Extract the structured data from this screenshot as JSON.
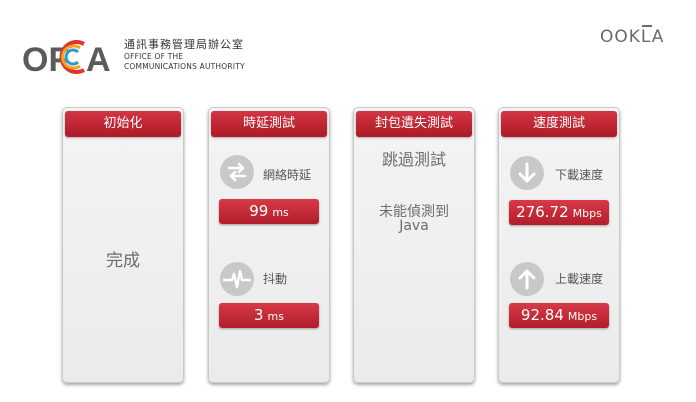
{
  "header": {
    "logo_mark": "OFCA",
    "logo_cn": "通訊事務管理局辦公室",
    "logo_en_line1": "OFFICE OF THE",
    "logo_en_line2": "COMMUNICATIONS AUTHORITY",
    "ookla": "OOKLA"
  },
  "colors": {
    "accent": "#c0222f",
    "panel_bg": "#efefef",
    "icon_gray": "#c8c8c8"
  },
  "panels": {
    "init": {
      "title": "初始化",
      "status": "完成"
    },
    "latency": {
      "title": "時延測試",
      "latency_label": "網絡時延",
      "latency_value": "99",
      "latency_unit": "ms",
      "jitter_label": "抖動",
      "jitter_value": "3",
      "jitter_unit": "ms",
      "latency_icon": "swap-arrows-icon",
      "jitter_icon": "waveform-icon"
    },
    "packet_loss": {
      "title": "封包遺失測試",
      "skip_text": "跳過測試",
      "java_text_line1": "未能偵測到",
      "java_text_line2": "Java"
    },
    "speed": {
      "title": "速度測試",
      "download_label": "下載速度",
      "download_value": "276.72",
      "download_unit": "Mbps",
      "upload_label": "上載速度",
      "upload_value": "92.84",
      "upload_unit": "Mbps",
      "download_icon": "arrow-down-icon",
      "upload_icon": "arrow-up-icon"
    }
  }
}
